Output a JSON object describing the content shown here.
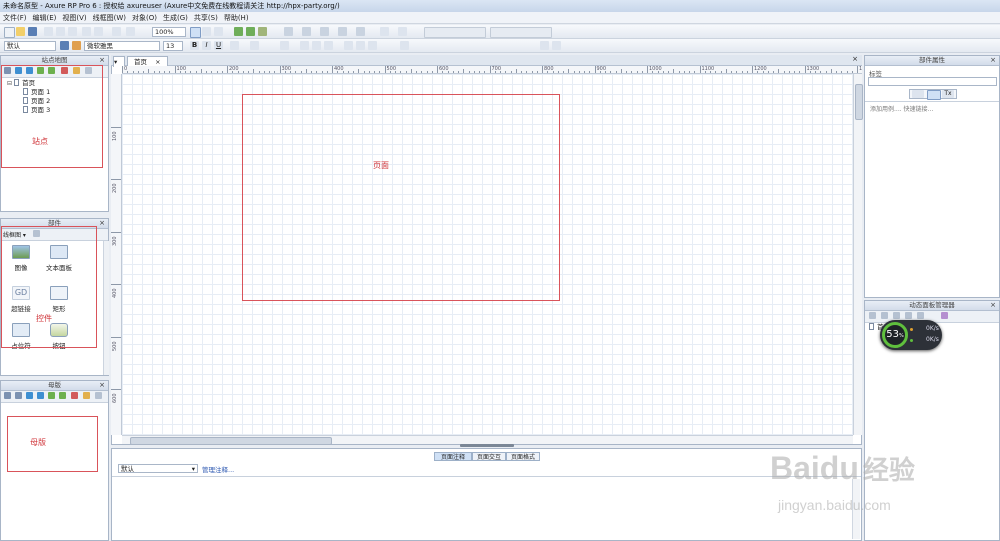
{
  "window": {
    "title": "未命名原型 - Axure RP Pro 6 : 授权给 axureuser (Axure中文免费在线教程请关注 http://hpx-party.org/)"
  },
  "menu": [
    "文件(F)",
    "编辑(E)",
    "视图(V)",
    "线框图(W)",
    "对象(O)",
    "生成(G)",
    "共享(S)",
    "帮助(H)"
  ],
  "toolbar": {
    "zoom": "100%",
    "style_select": "默认",
    "font_select": "微软雅黑",
    "font_size": "13"
  },
  "sitemap": {
    "title": "站点地图",
    "root": "首页",
    "pages": [
      "页面 1",
      "页面 2",
      "页面 3"
    ],
    "annotation": "站点"
  },
  "widgets": {
    "title": "部件",
    "library": "线框图",
    "items": [
      "图像",
      "文本面板",
      "超链接",
      "矩形",
      "占位符",
      "按钮"
    ],
    "annotation": "控件"
  },
  "masters": {
    "title": "母版",
    "annotation": "母版"
  },
  "canvas": {
    "tab": "首页",
    "page_label": "页面",
    "ruler_h": [
      "0",
      "100",
      "200",
      "300",
      "400",
      "500",
      "600",
      "700",
      "800",
      "900",
      "1000",
      "1100",
      "1200",
      "1300",
      "1400"
    ],
    "ruler_v": [
      "100",
      "200",
      "300",
      "400",
      "500",
      "600"
    ]
  },
  "bottom": {
    "tabs": [
      "页面注释",
      "页面交互",
      "页面格式"
    ],
    "notes_select": "默认",
    "manage_link": "管理注释..."
  },
  "properties": {
    "title": "部件属性",
    "label": "标签",
    "hint": "添加用例.... 快速链接..."
  },
  "dynamic": {
    "title": "动态面板管理器",
    "item": "首"
  },
  "speed_widget": {
    "percent": "53",
    "unit": "%",
    "up": "0K/s",
    "down": "0K/s"
  },
  "watermark": {
    "brand": "Baidu",
    "brand_cn": "经验",
    "url": "jingyan.baidu.com"
  },
  "colors": {
    "annotation": "#d0353a",
    "accent": "#3c6fb6"
  }
}
